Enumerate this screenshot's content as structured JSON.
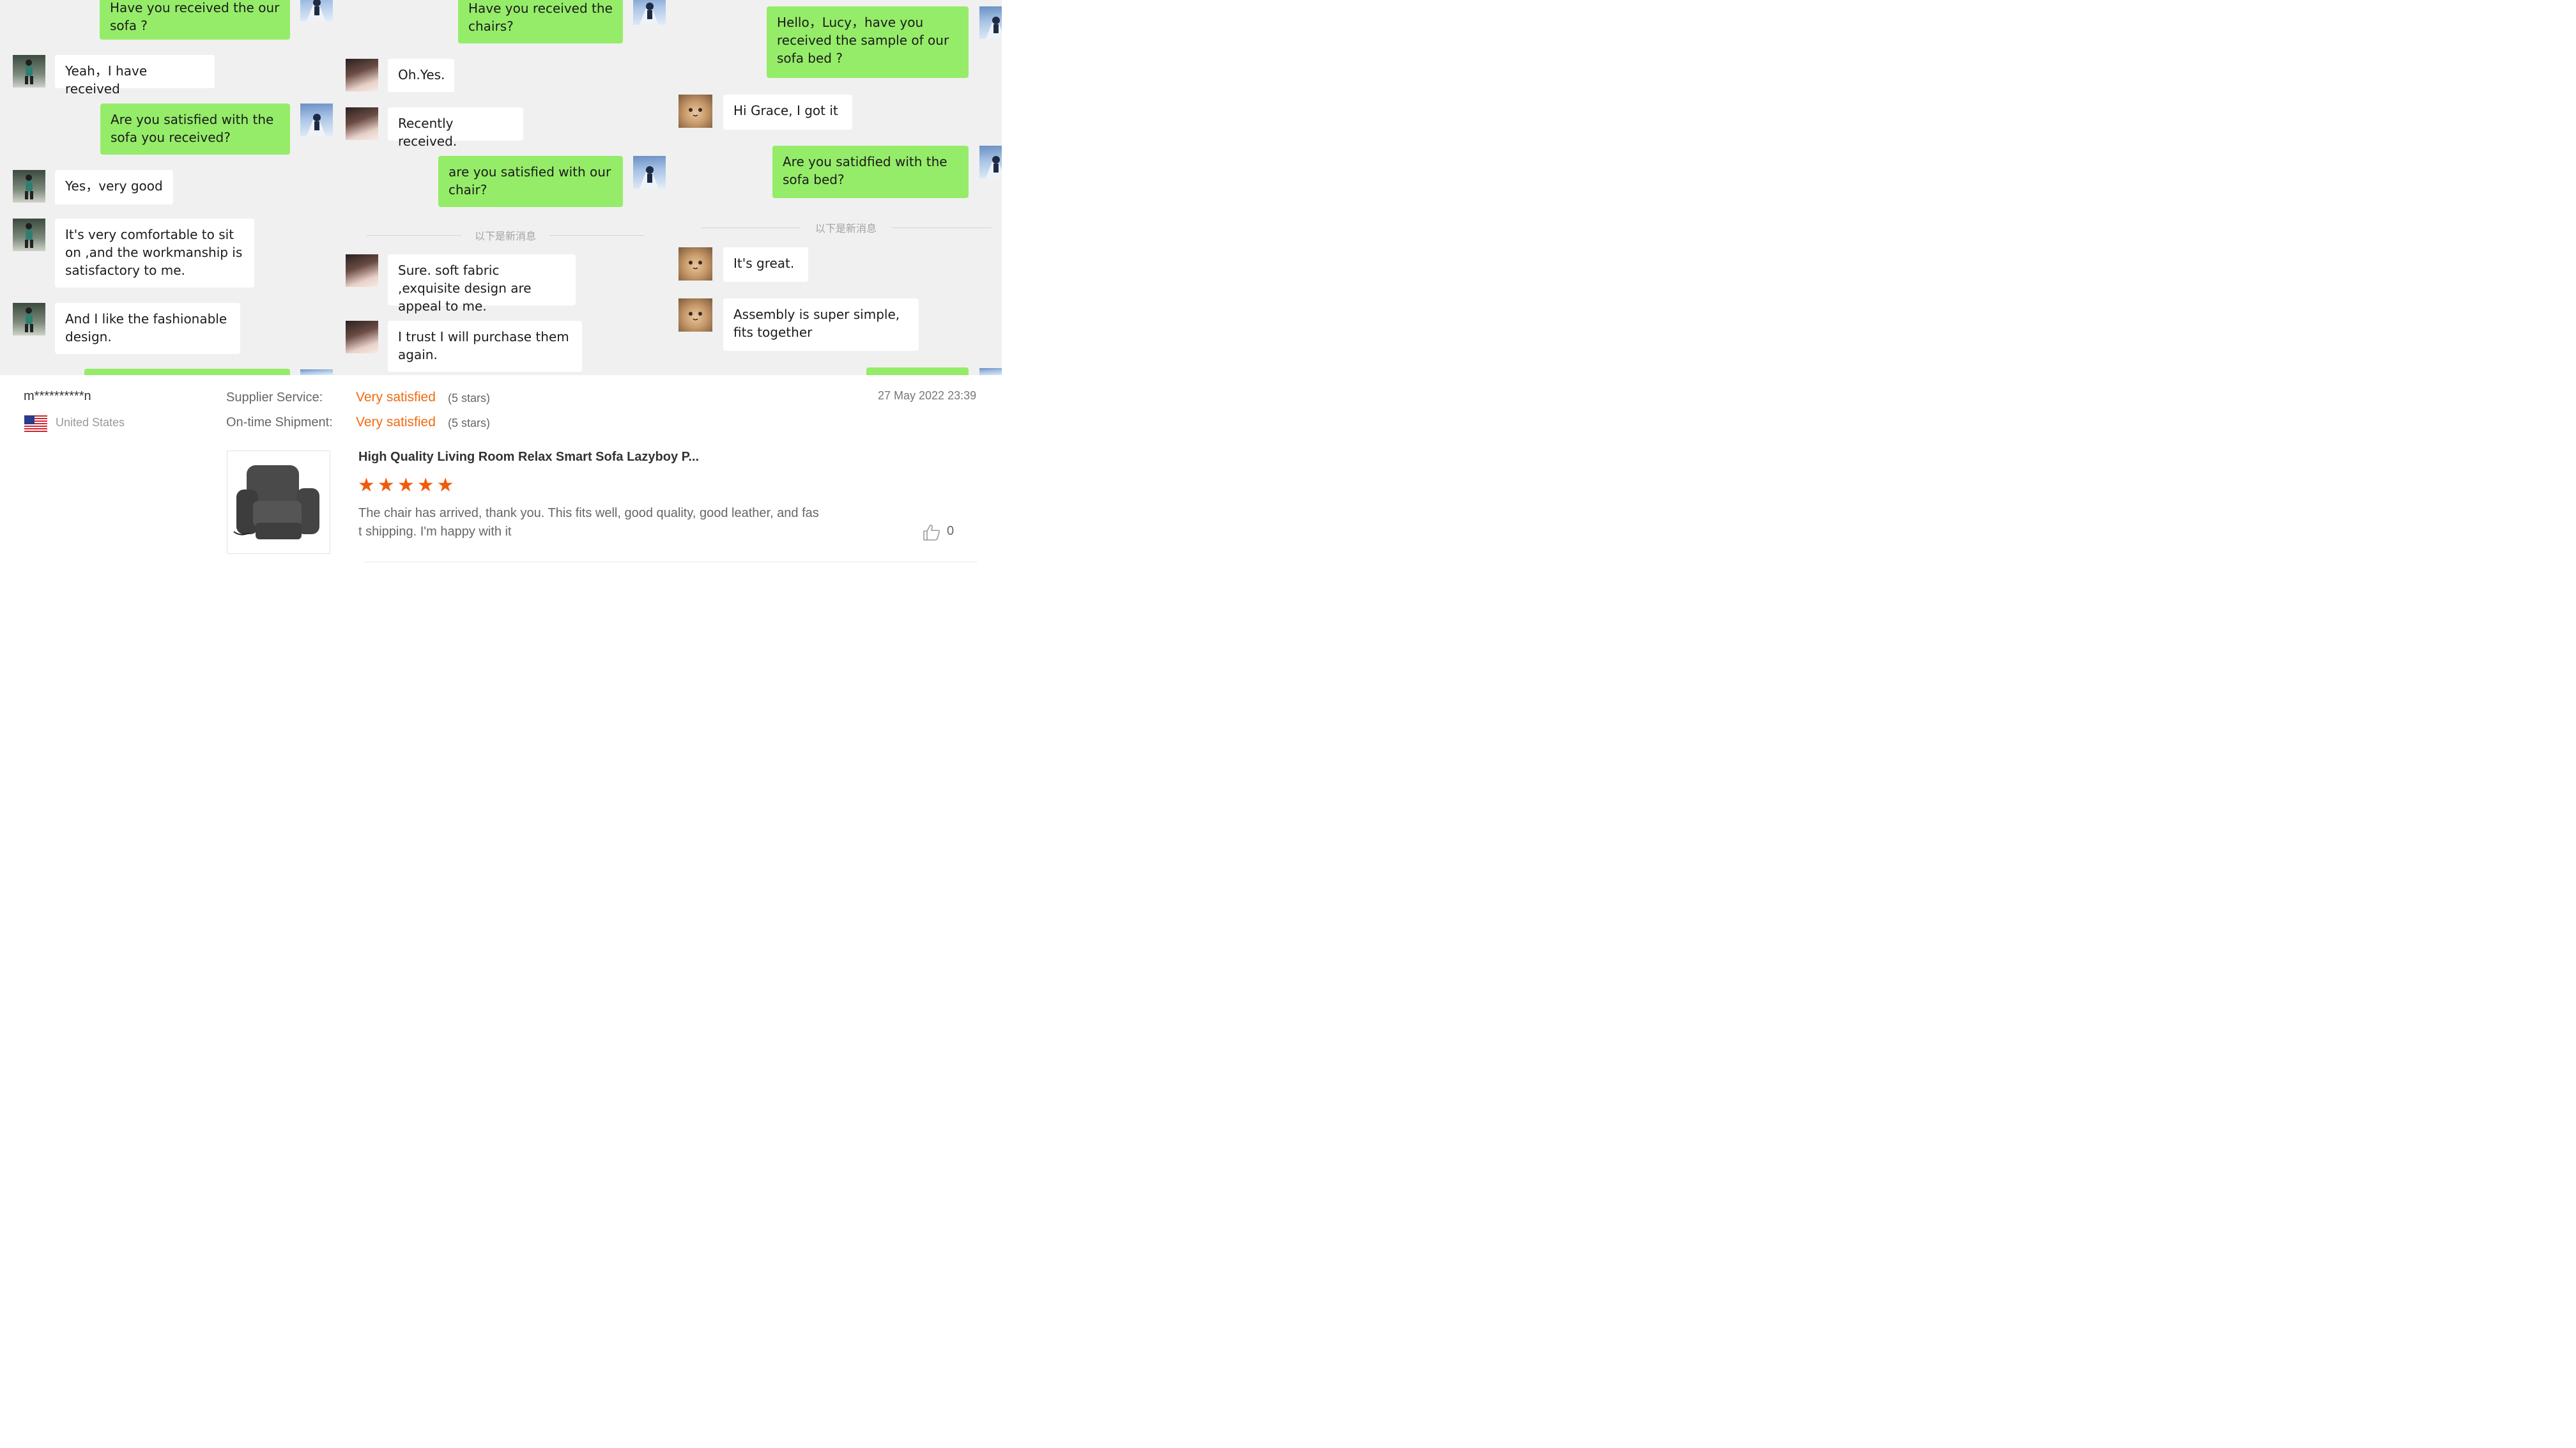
{
  "chat_columns": [
    {
      "messages": [
        {
          "side": "out",
          "text": "Have you received the our sofa ?"
        },
        {
          "side": "in",
          "avatar": "user-avatar-boy",
          "text": "Yeah，I have received"
        },
        {
          "side": "out",
          "text": "Are you  satisfied with the sofa you received?"
        },
        {
          "side": "in",
          "avatar": "user-avatar-boy",
          "text": "Yes，very good"
        },
        {
          "side": "in",
          "avatar": "user-avatar-boy",
          "text": "It's very comfortable to sit on ,and the workmanship is satisfactory to me."
        },
        {
          "side": "in",
          "avatar": "user-avatar-boy",
          "text": "And I like the fashionable design."
        }
      ]
    },
    {
      "messages": [
        {
          "side": "out",
          "text": "Have you received the chairs?"
        },
        {
          "side": "in",
          "avatar": "user-avatar-girl",
          "text": "Oh.Yes."
        },
        {
          "side": "in",
          "avatar": "user-avatar-girl",
          "text": "Recently received."
        },
        {
          "side": "out",
          "text": "are you satisfied with our chair?"
        },
        {
          "side": "in",
          "avatar": "user-avatar-girl",
          "text": "Sure. soft fabric ,exquisite design are appeal to me."
        },
        {
          "side": "in",
          "avatar": "user-avatar-girl",
          "text": "I trust I will purchase them again."
        }
      ],
      "divider_text": "以下是新消息"
    },
    {
      "messages": [
        {
          "side": "out",
          "text": "Hello，Lucy，have you received the sample of our sofa bed ?"
        },
        {
          "side": "in",
          "avatar": "user-avatar-cat",
          "text": "Hi Grace, I got it"
        },
        {
          "side": "out",
          "text": "Are you satidfied with the sofa bed?"
        },
        {
          "side": "in",
          "avatar": "user-avatar-cat",
          "text": "It's great."
        },
        {
          "side": "in",
          "avatar": "user-avatar-cat",
          "text": "Assembly is super simple, fits together"
        }
      ],
      "divider_text": "以下是新消息"
    }
  ],
  "review": {
    "reviewer_name": "m**********n",
    "country": "United States",
    "supplier_service_label": "Supplier Service:",
    "supplier_service_value": "Very satisfied",
    "supplier_service_stars": "(5 stars)",
    "shipment_label": "On-time Shipment:",
    "shipment_value": "Very satisfied",
    "shipment_stars": "(5 stars)",
    "date": "27 May 2022 23:39",
    "product_title": "High Quality Living Room Relax Smart Sofa Lazyboy P...",
    "rating": 5,
    "rating_max": 5,
    "review_text_line1": "The chair has arrived, thank you.  This fits well, good quality, good leather, and fas",
    "review_text_line2": "t shipping.  I'm happy with it",
    "likes": "0"
  },
  "colors": {
    "outgoing_bubble": "#95ec69",
    "incoming_bubble": "#ffffff",
    "chat_background": "#f0f0f0",
    "accent_orange": "#f26a0f",
    "star": "#f15a0c"
  }
}
